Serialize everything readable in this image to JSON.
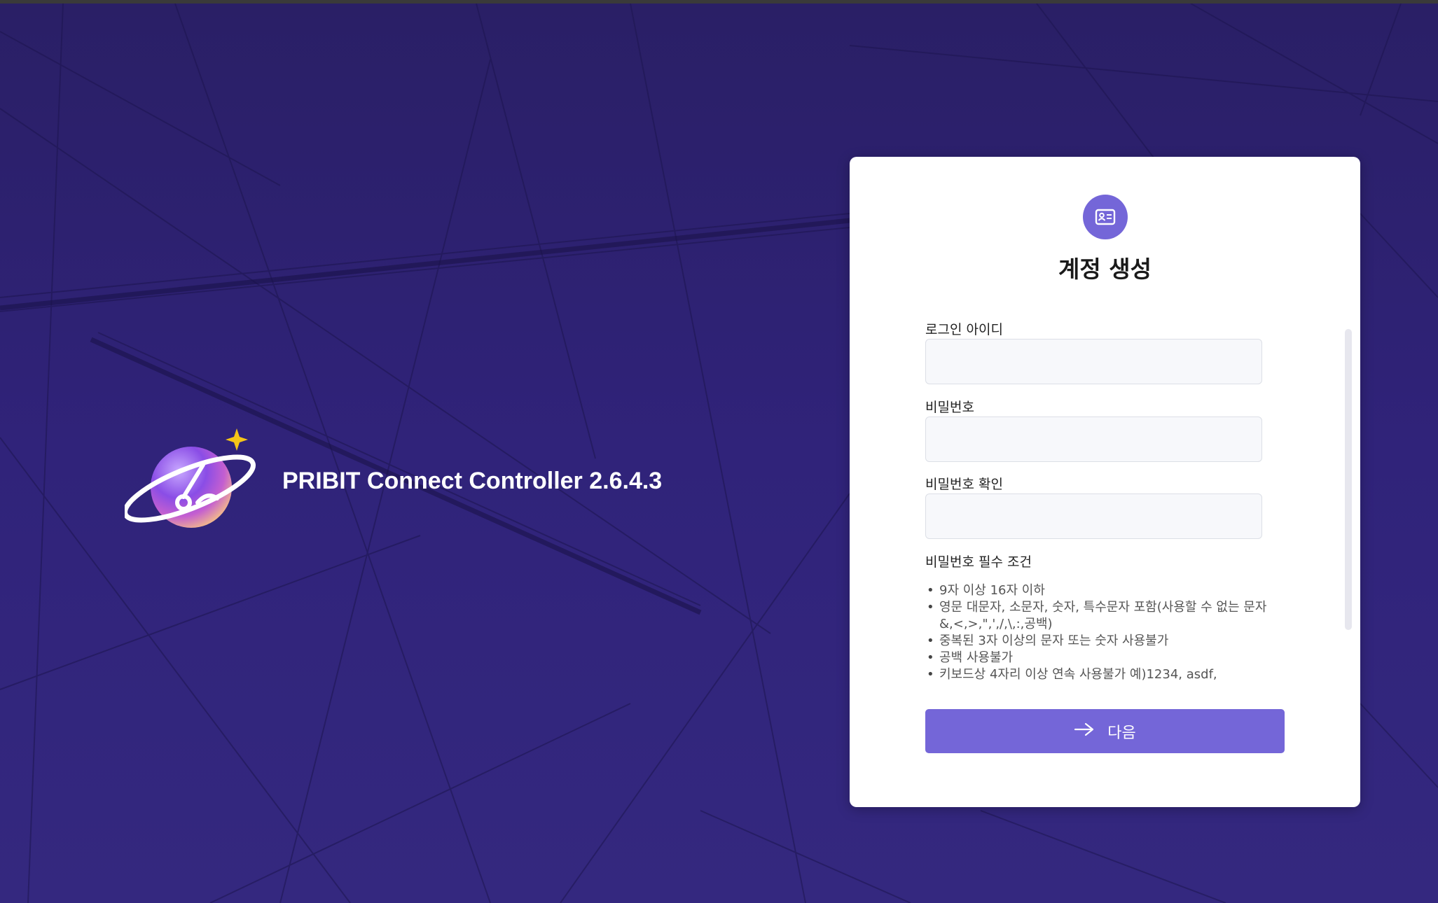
{
  "app": {
    "title": "PRIBIT Connect Controller 2.6.4.3"
  },
  "form": {
    "title": "계정 생성",
    "icon": "id-card-icon",
    "fields": [
      {
        "label": "로그인 아이디",
        "value": "",
        "placeholder": ""
      },
      {
        "label": "비밀번호",
        "value": "",
        "placeholder": ""
      },
      {
        "label": "비밀번호 확인",
        "value": "",
        "placeholder": ""
      }
    ],
    "requirements_title": "비밀번호 필수 조건",
    "requirements": [
      "9자 이상 16자 이하",
      "영문 대문자, 소문자, 숫자, 특수문자 포함(사용할 수 없는 문자 &,<,>,\",',/,\\,:,공백)",
      "중복된 3자 이상의 문자 또는 숫자 사용불가",
      "공백 사용불가",
      "키보드상 4자리 이상 연속 사용불가 예)1234, asdf,"
    ],
    "next_button": "다음"
  },
  "colors": {
    "accent": "#7466d8",
    "background": "#2c2170",
    "card": "#ffffff"
  }
}
